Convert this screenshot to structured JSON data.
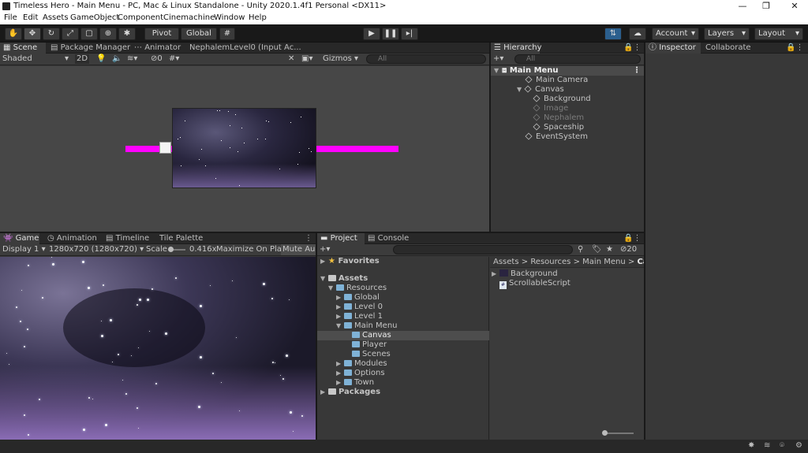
{
  "window": {
    "title": "Timeless Hero - Main Menu - PC, Mac & Linux Standalone - Unity 2020.1.4f1 Personal <DX11>",
    "minimize": "—",
    "restore": "❐",
    "close": "✕"
  },
  "menu": [
    "File",
    "Edit",
    "Assets",
    "GameObject",
    "Component",
    "Cinemachine",
    "Window",
    "Help"
  ],
  "toolbar": {
    "pivot": "Pivot",
    "global": "Global",
    "account": "Account",
    "layers": "Layers",
    "layout": "Layout"
  },
  "scene": {
    "tabs": [
      "Scene",
      "Package Manager",
      "Animator",
      "NephalemLevel0 (Input Ac..."
    ],
    "shading": "Shaded",
    "mode2d": "2D",
    "hidden_count": "0",
    "gizmos": "Gizmos",
    "search_placeholder": "All"
  },
  "hierarchy": {
    "tab": "Hierarchy",
    "search_placeholder": "All",
    "items": [
      {
        "label": "Main Menu",
        "level": 0,
        "dim": false
      },
      {
        "label": "Main Camera",
        "level": 1,
        "dim": false
      },
      {
        "label": "Canvas",
        "level": 1,
        "dim": false
      },
      {
        "label": "Background",
        "level": 2,
        "dim": false
      },
      {
        "label": "Image",
        "level": 2,
        "dim": true
      },
      {
        "label": "Nephalem",
        "level": 2,
        "dim": true
      },
      {
        "label": "Spaceship",
        "level": 2,
        "dim": false
      },
      {
        "label": "EventSystem",
        "level": 1,
        "dim": false
      }
    ]
  },
  "inspector": {
    "tabs": [
      "Inspector",
      "Collaborate"
    ]
  },
  "game": {
    "tabs": [
      "Game",
      "Animation",
      "Timeline",
      "Tile Palette"
    ],
    "display": "Display 1",
    "resolution": "1280x720 (1280x720)",
    "scale_label": "Scale",
    "scale_value": "0.416x",
    "maximize": "Maximize On Play",
    "mute": "Mute Aud"
  },
  "project": {
    "tabs": [
      "Project",
      "Console"
    ],
    "hidden_count": "20",
    "breadcrumb": [
      "Assets",
      "Resources",
      "Main Menu",
      "Canvas"
    ],
    "tree": [
      {
        "label": "Favorites"
      },
      {
        "label": "Assets"
      },
      {
        "label": "Resources"
      },
      {
        "label": "Global"
      },
      {
        "label": "Level 0"
      },
      {
        "label": "Level 1"
      },
      {
        "label": "Main Menu"
      },
      {
        "label": "Canvas"
      },
      {
        "label": "Player"
      },
      {
        "label": "Scenes"
      },
      {
        "label": "Modules"
      },
      {
        "label": "Options"
      },
      {
        "label": "Town"
      },
      {
        "label": "Packages"
      }
    ],
    "files": [
      "Background",
      "ScrollableScript"
    ]
  },
  "colors": {
    "magenta": "#ff00ff",
    "selection": "#2c5d87",
    "space": "#1c1a2e"
  }
}
